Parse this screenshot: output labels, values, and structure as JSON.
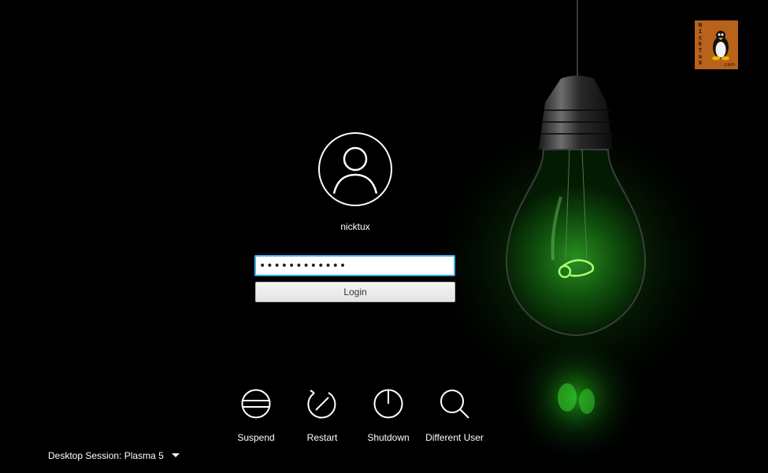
{
  "logo": {
    "letters": "NickTuX",
    "suffix": ".com",
    "background": "#b8621a"
  },
  "user": {
    "avatar_icon": "user-icon",
    "name": "nicktux"
  },
  "password": {
    "value": "123456789012",
    "focus_color": "#3daee9"
  },
  "login": {
    "label": "Login"
  },
  "actions": [
    {
      "icon": "suspend-icon",
      "label": "Suspend"
    },
    {
      "icon": "restart-icon",
      "label": "Restart"
    },
    {
      "icon": "shutdown-icon",
      "label": "Shutdown"
    },
    {
      "icon": "search-icon",
      "label": "Different User"
    }
  ],
  "session": {
    "prefix": "Desktop Session:",
    "value": "Plasma 5"
  },
  "colors": {
    "background": "#000000",
    "bulb_glow": "#2fd12a",
    "text": "#ffffff"
  }
}
